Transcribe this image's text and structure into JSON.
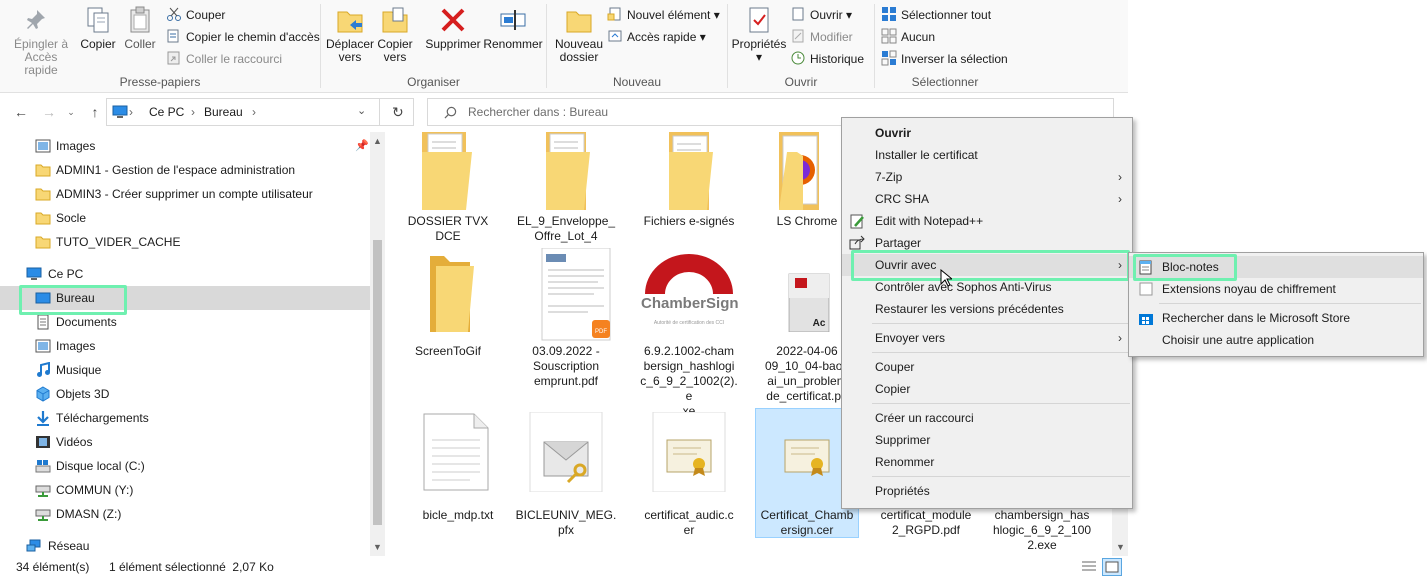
{
  "ribbon": {
    "groups": {
      "clipboard": "Presse-papiers",
      "organize": "Organiser",
      "new": "Nouveau",
      "open": "Ouvrir",
      "select": "Sélectionner"
    },
    "pin": "Épingler à\nAccès rapide",
    "copy": "Copier",
    "paste": "Coller",
    "cut": "Couper",
    "copy_path": "Copier le chemin d'accès",
    "paste_shortcut": "Coller le raccourci",
    "move_to": "Déplacer\nvers",
    "copy_to": "Copier\nvers",
    "delete": "Supprimer",
    "rename": "Renommer",
    "new_folder": "Nouveau\ndossier",
    "new_item": "Nouvel élément",
    "easy_access": "Accès rapide",
    "properties": "Propriétés",
    "open": "Ouvrir",
    "edit": "Modifier",
    "history": "Historique",
    "select_all": "Sélectionner tout",
    "select_none": "Aucun",
    "invert_selection": "Inverser la sélection"
  },
  "address": {
    "crumbs": [
      "Ce PC",
      "Bureau"
    ],
    "search_placeholder": "Rechercher dans : Bureau"
  },
  "sidebar": {
    "items": [
      {
        "label": "Images",
        "icon": "images-icon"
      },
      {
        "label": "ADMIN1 - Gestion de l'espace administration",
        "icon": "folder-icon"
      },
      {
        "label": "ADMIN3 - Créer supprimer un compte utilisateur",
        "icon": "folder-icon"
      },
      {
        "label": "Socle",
        "icon": "folder-icon"
      },
      {
        "label": "TUTO_VIDER_CACHE",
        "icon": "folder-icon"
      },
      {
        "label": "Ce PC",
        "icon": "computer-icon"
      },
      {
        "label": "Bureau",
        "icon": "desktop-icon"
      },
      {
        "label": "Documents",
        "icon": "documents-icon"
      },
      {
        "label": "Images",
        "icon": "images-icon"
      },
      {
        "label": "Musique",
        "icon": "music-icon"
      },
      {
        "label": "Objets 3D",
        "icon": "objects3d-icon"
      },
      {
        "label": "Téléchargements",
        "icon": "downloads-icon"
      },
      {
        "label": "Vidéos",
        "icon": "videos-icon"
      },
      {
        "label": "Disque local (C:)",
        "icon": "drive-icon"
      },
      {
        "label": "COMMUN (Y:)",
        "icon": "network-drive-icon"
      },
      {
        "label": "DMASN (Z:)",
        "icon": "network-drive-icon"
      },
      {
        "label": "Réseau",
        "icon": "network-icon"
      }
    ]
  },
  "files": [
    {
      "name": "DOSSIER TVX\nDCE",
      "type": "folder-docs"
    },
    {
      "name": "EL_9_Enveloppe_\nOffre_Lot_4",
      "type": "folder-docs"
    },
    {
      "name": "Fichiers e-signés",
      "type": "folder-docs"
    },
    {
      "name": "LS Chrome",
      "type": "folder-firefox"
    },
    {
      "name": "ScreenToGif",
      "type": "folder"
    },
    {
      "name": "03.09.2022 -\nSouscription\nemprunt.pdf",
      "type": "pdf-doc"
    },
    {
      "name": "6.9.2.1002-cham\nbersign_hashlogi\nc_6_9_2_1002(2).e\nxe",
      "type": "chambersign"
    },
    {
      "name": "2022-04-06\n09_10_04-bao3\nai_un_problem\nde_certificat.pd",
      "type": "pdf-cert"
    },
    {
      "name": "bicle_mdp.txt",
      "type": "txt"
    },
    {
      "name": "BICLEUNIV_MEG.\npfx",
      "type": "pfx"
    },
    {
      "name": "certificat_audic.c\ner",
      "type": "cer"
    },
    {
      "name": "Certificat_Chamb\nersign.cer",
      "type": "cer"
    },
    {
      "name": "certificat_module\n2_RGPD.pdf",
      "type": "pdf"
    },
    {
      "name": "chambersign_has\nhlogic_6_9_2_100\n2.exe",
      "type": "exe"
    }
  ],
  "chambersign_brand": "ChamberSign",
  "chambersign_tagline": "Autorité de certification des CCI",
  "status": {
    "count": "34 élément(s)",
    "selection": "1 élément sélectionné  2,07 Ko"
  },
  "context_menu": {
    "items": [
      "Ouvrir",
      "Installer le certificat",
      "7-Zip",
      "CRC SHA",
      "Edit with Notepad++",
      "Partager",
      "Ouvrir avec",
      "Contrôler avec Sophos Anti-Virus",
      "Restaurer les versions précédentes",
      "Envoyer vers",
      "Couper",
      "Copier",
      "Créer un raccourci",
      "Supprimer",
      "Renommer",
      "Propriétés"
    ]
  },
  "submenu": {
    "items": [
      "Bloc-notes",
      "Extensions noyau de chiffrement",
      "Rechercher dans le Microsoft Store",
      "Choisir une autre application"
    ]
  },
  "colors": {
    "highlight": "#6ff0b0",
    "selection": "#cce8ff",
    "folder": "#f8d775",
    "accent": "#0078d7"
  }
}
